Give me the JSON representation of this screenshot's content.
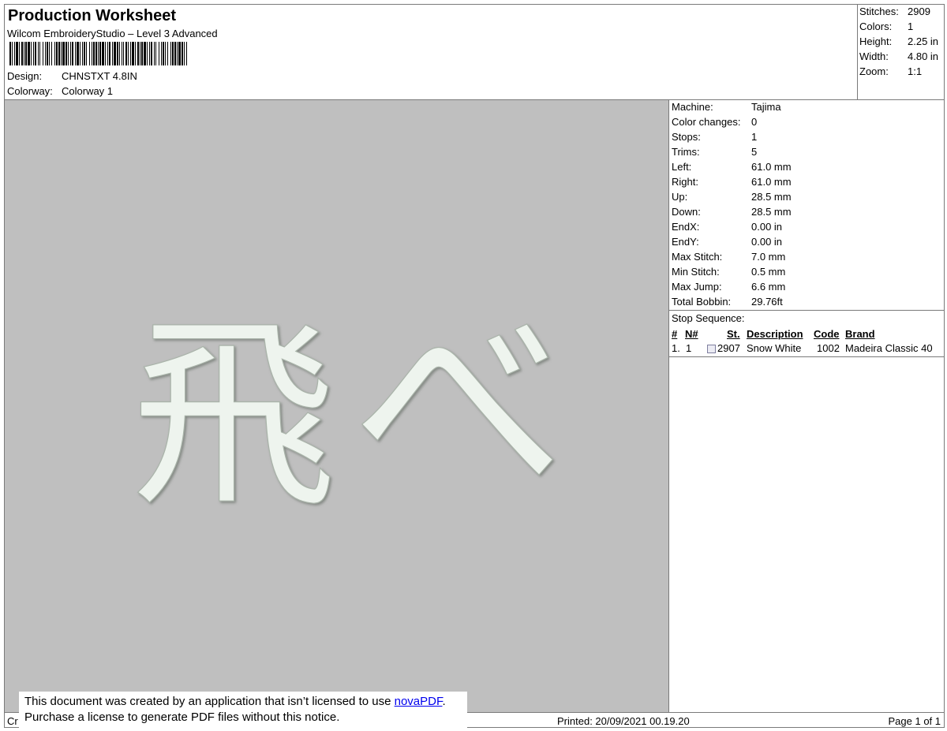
{
  "header": {
    "title": "Production Worksheet",
    "subtitle": "Wilcom EmbroideryStudio – Level 3 Advanced",
    "design_label": "Design:",
    "design_value": "CHNSTXT 4.8IN",
    "colorway_label": "Colorway:",
    "colorway_value": "Colorway 1"
  },
  "summary": [
    {
      "label": "Stitches:",
      "value": "2909"
    },
    {
      "label": "Colors:",
      "value": "1"
    },
    {
      "label": "Height:",
      "value": "2.25 in"
    },
    {
      "label": "Width:",
      "value": "4.80 in"
    },
    {
      "label": "Zoom:",
      "value": "1:1"
    }
  ],
  "design": {
    "glyph_left": "飛",
    "glyph_right": "べ",
    "thread_color": "#eef4ee",
    "background": "#bfbfbf"
  },
  "machine_info": [
    {
      "label": "Machine:",
      "value": "Tajima"
    },
    {
      "label": "Color changes:",
      "value": "0"
    },
    {
      "label": "Stops:",
      "value": "1"
    },
    {
      "label": "Trims:",
      "value": "5"
    },
    {
      "label": "Left:",
      "value": "61.0 mm"
    },
    {
      "label": "Right:",
      "value": "61.0 mm"
    },
    {
      "label": "Up:",
      "value": "28.5 mm"
    },
    {
      "label": "Down:",
      "value": "28.5 mm"
    },
    {
      "label": "EndX:",
      "value": "0.00 in"
    },
    {
      "label": "EndY:",
      "value": "0.00 in"
    },
    {
      "label": "Max Stitch:",
      "value": "7.0 mm"
    },
    {
      "label": "Min Stitch:",
      "value": "0.5 mm"
    },
    {
      "label": "Max Jump:",
      "value": "6.6 mm"
    },
    {
      "label": "Total Bobbin:",
      "value": "29.76ft"
    }
  ],
  "stop_sequence": {
    "title": "Stop Sequence:",
    "columns": [
      "#",
      "N#",
      "St.",
      "Description",
      "Code",
      "Brand"
    ],
    "rows": [
      {
        "num": "1.",
        "n": "1",
        "st": "2907",
        "description": "Snow White",
        "code": "1002",
        "brand": "Madeira Classic 40",
        "swatch_color": "#ececf4"
      }
    ]
  },
  "footer": {
    "left": "Cr",
    "printed": "Printed: 20/09/2021 00.19.20",
    "page": "Page 1 of 1"
  },
  "notice": {
    "line1_prefix": "This document was created by an application that isn’t licensed to use ",
    "link": "novaPDF",
    "line1_suffix": ".",
    "line2": "Purchase a license to generate PDF files without this notice."
  }
}
